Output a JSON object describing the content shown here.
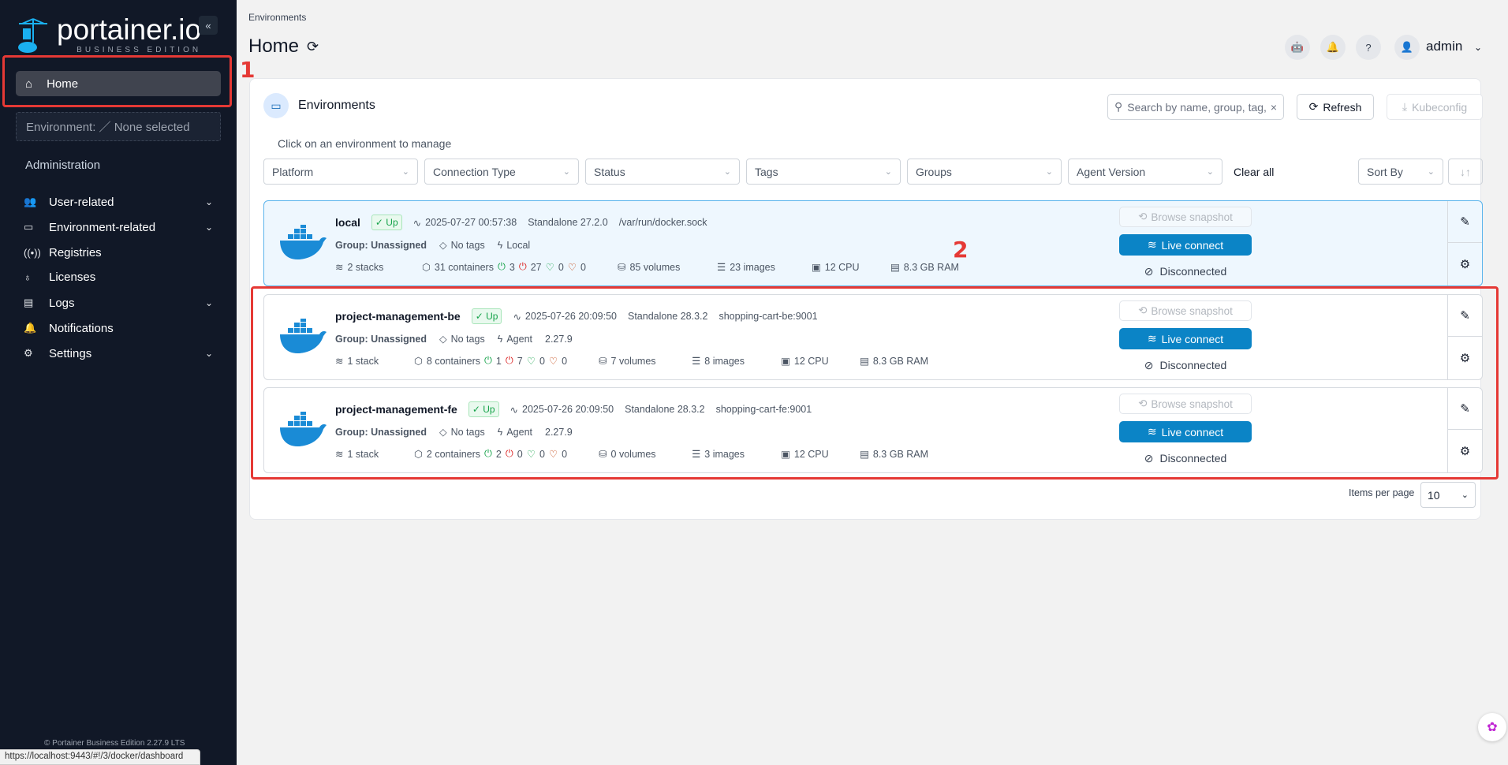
{
  "sidebar": {
    "brand": "portainer.io",
    "edition": "BUSINESS EDITION",
    "collapse": "«",
    "home": "Home",
    "environment": "Environment: ／ None selected",
    "admin_heading": "Administration",
    "items": [
      {
        "label": "User-related",
        "icon": "users-icon",
        "chev": true
      },
      {
        "label": "Environment-related",
        "icon": "hdd-icon",
        "chev": true
      },
      {
        "label": "Registries",
        "icon": "radio-icon",
        "chev": false
      },
      {
        "label": "Licenses",
        "icon": "award-icon",
        "chev": false
      },
      {
        "label": "Logs",
        "icon": "file-icon",
        "chev": true
      },
      {
        "label": "Notifications",
        "icon": "bell-icon",
        "chev": false
      },
      {
        "label": "Settings",
        "icon": "gear-icon",
        "chev": true
      }
    ],
    "footer": "© Portainer Business Edition 2.27.9 LTS"
  },
  "status_url": "https://localhost:9443/#!/3/docker/dashboard",
  "header": {
    "breadcrumb": "Environments",
    "title": "Home",
    "user": "admin"
  },
  "panel": {
    "title": "Environments",
    "search_placeholder": "Search by name, group, tag, status, URL...",
    "refresh": "Refresh",
    "kubeconfig": "Kubeconfig",
    "hint": "Click on an environment to manage",
    "filters": [
      "Platform",
      "Connection Type",
      "Status",
      "Tags",
      "Groups",
      "Agent Version"
    ],
    "clear_all": "Clear all",
    "sort_by": "Sort By",
    "items_per_page_label": "Items per page",
    "items_per_page": "10"
  },
  "environments": [
    {
      "name": "local",
      "status": "Up",
      "time": "2025-07-27 00:57:38",
      "engine": "Standalone 27.2.0",
      "url": "/var/run/docker.sock",
      "group": "Group: Unassigned",
      "tags": "No tags",
      "type": "Local",
      "version": "",
      "stacks": "2 stacks",
      "containers": "31 containers",
      "running": "3",
      "stopped": "27",
      "healthy": "0",
      "unhealthy": "0",
      "volumes": "85 volumes",
      "images": "23 images",
      "cpu": "12 CPU",
      "ram": "8.3 GB RAM",
      "snapshot": "Browse snapshot",
      "live": "Live connect",
      "conn": "Disconnected"
    },
    {
      "name": "project-management-be",
      "status": "Up",
      "time": "2025-07-26 20:09:50",
      "engine": "Standalone 28.3.2",
      "url": "shopping-cart-be:9001",
      "group": "Group: Unassigned",
      "tags": "No tags",
      "type": "Agent",
      "version": "2.27.9",
      "stacks": "1 stack",
      "containers": "8 containers",
      "running": "1",
      "stopped": "7",
      "healthy": "0",
      "unhealthy": "0",
      "volumes": "7 volumes",
      "images": "8 images",
      "cpu": "12 CPU",
      "ram": "8.3 GB RAM",
      "snapshot": "Browse snapshot",
      "live": "Live connect",
      "conn": "Disconnected"
    },
    {
      "name": "project-management-fe",
      "status": "Up",
      "time": "2025-07-26 20:09:50",
      "engine": "Standalone 28.3.2",
      "url": "shopping-cart-fe:9001",
      "group": "Group: Unassigned",
      "tags": "No tags",
      "type": "Agent",
      "version": "2.27.9",
      "stacks": "1 stack",
      "containers": "2 containers",
      "running": "2",
      "stopped": "0",
      "healthy": "0",
      "unhealthy": "0",
      "volumes": "0 volumes",
      "images": "3 images",
      "cpu": "12 CPU",
      "ram": "8.3 GB RAM",
      "snapshot": "Browse snapshot",
      "live": "Live connect",
      "conn": "Disconnected"
    }
  ],
  "annotations": [
    "1",
    "2"
  ],
  "colors": {
    "sidebar": "#111827",
    "accent": "#0b84c6",
    "annotation": "#e53935"
  }
}
